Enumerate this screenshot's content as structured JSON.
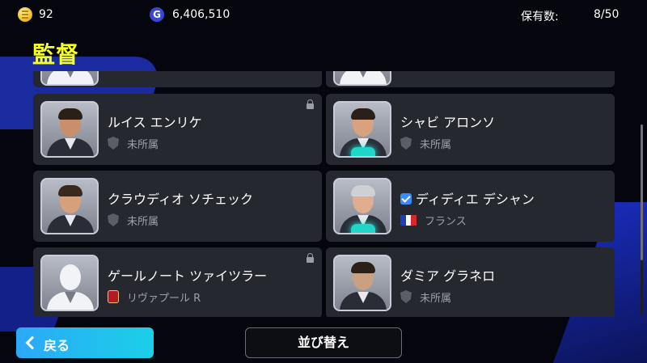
{
  "header": {
    "coins": "92",
    "gp": "6,406,510",
    "gp_icon_label": "G",
    "owned_label": "保有数:",
    "owned_value": "8/50"
  },
  "title": "監督",
  "managers": [
    {
      "name": "ルイス エンリケ",
      "club": "未所属",
      "club_icon": "shield-icon",
      "locked": true,
      "selected": false
    },
    {
      "name": "シャビ アロンソ",
      "club": "未所属",
      "club_icon": "shield-icon",
      "locked": false,
      "selected": false
    },
    {
      "name": "クラウディオ ソチェック",
      "club": "未所属",
      "club_icon": "shield-icon",
      "locked": false,
      "selected": false
    },
    {
      "name": "ディディエ デシャン",
      "club": "フランス",
      "club_icon": "france-flag-icon",
      "locked": false,
      "selected": true
    },
    {
      "name": "ゲールノート ツァイツラー",
      "club": "リヴァプール R",
      "club_icon": "club-crest-icon",
      "locked": true,
      "selected": false
    },
    {
      "name": "ダミア グラネロ",
      "club": "未所属",
      "club_icon": "shield-icon",
      "locked": false,
      "selected": false
    }
  ],
  "buttons": {
    "back": "戻る",
    "sort": "並び替え"
  },
  "colors": {
    "title": "#f5ff2a",
    "back_button": "#2aa9f6",
    "card": "#262830",
    "badge": "#1fd6c9"
  }
}
